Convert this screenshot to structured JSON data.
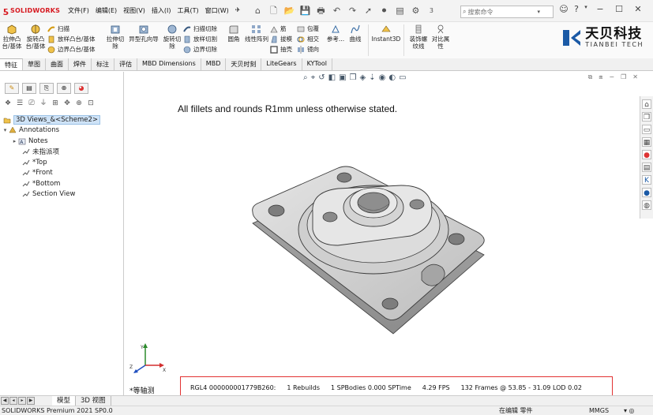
{
  "app": {
    "brand": "SOLIDWORKS",
    "menus": [
      "文件(F)",
      "编辑(E)",
      "视图(V)",
      "插入(I)",
      "工具(T)",
      "窗口(W)"
    ],
    "search_placeholder": "搜索命令",
    "counter": "3"
  },
  "ribbon": {
    "extrude_boss": "拉伸凸\n台/基体",
    "revolve_boss": "旋转凸\n台/基体",
    "sweep": "扫描",
    "loft": "放样凸台/基体",
    "boundary": "边界凸台/基体",
    "extrude_cut": "拉伸切\n除",
    "hole_wizard": "异型孔向导",
    "revolve_cut": "旋转切\n除",
    "swept_cut": "扫描切除",
    "lofted_cut": "放样切割",
    "boundary_cut": "边界切除",
    "fillet": "圆角",
    "linear_pattern": "线性阵列",
    "rib": "筋",
    "draft": "拔模",
    "shell": "抽壳",
    "wrap": "包覆",
    "intersect": "相交",
    "mirror": "镜向",
    "reference": "参考...",
    "curves": "曲线",
    "instant3d": "Instant3D",
    "cosmetic_thread": "装饰螺\n纹线",
    "compare": "对比属\n性"
  },
  "company": {
    "name_cn": "天贝科技",
    "name_en": "TIANBEI TECH"
  },
  "tabs": [
    "特征",
    "草图",
    "曲面",
    "焊件",
    "标注",
    "评估",
    "MBD Dimensions",
    "MBD",
    "天贝时刻",
    "LiteGears",
    "KYTool"
  ],
  "tree": {
    "root": "3D Views_&<Scheme2>",
    "annotations": "Annotations",
    "notes": "Notes",
    "items": [
      "未指派项",
      "*Top",
      "*Front",
      "*Bottom",
      "Section View"
    ]
  },
  "viewport": {
    "note": "All fillets and rounds R1mm unless otherwise stated.",
    "view_name": "*等轴测",
    "stats": {
      "rebuild_id": "RGL4 000000001779B260:",
      "rebuilds": "1 Rebuilds",
      "sptime": "1 SPBodies  0.000 SPTime",
      "fps": "4.29 FPS",
      "frames": "132 Frames @  53.85 -  31.09 LOD 0.02"
    }
  },
  "bottom_tabs": [
    "模型",
    "3D 视图"
  ],
  "status": {
    "version": "SOLIDWORKS Premium 2021 SP0.0",
    "mode": "在编辑 零件",
    "units": "MMGS"
  },
  "colors": {
    "accent_red": "#d71920",
    "selection": "#cfe3f7",
    "stats_border": "#e23232",
    "part_gray": "#c8c8c8"
  }
}
